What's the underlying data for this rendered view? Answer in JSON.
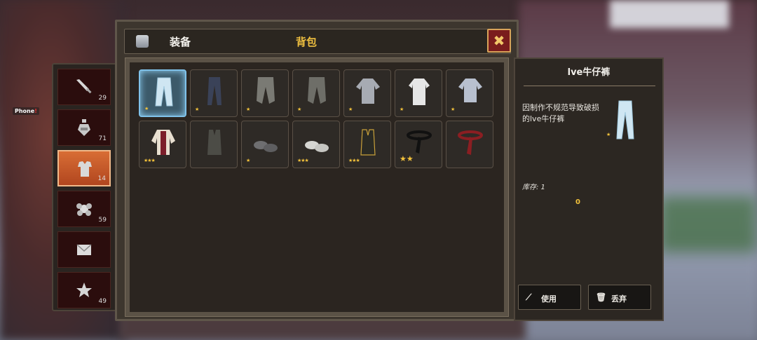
{
  "hud": {
    "phone_label": "Phone",
    "phone_alert": "!"
  },
  "sidebar": {
    "tabs": [
      {
        "icon": "sword-icon",
        "count": "29",
        "active": false
      },
      {
        "icon": "potion-icon",
        "count": "71",
        "active": false
      },
      {
        "icon": "armor-icon",
        "count": "14",
        "active": true
      },
      {
        "icon": "ore-icon",
        "count": "59",
        "active": false
      },
      {
        "icon": "mail-icon",
        "count": "",
        "active": false
      },
      {
        "icon": "star-icon",
        "count": "49",
        "active": false
      }
    ]
  },
  "panel": {
    "tab_equipment": "装备",
    "tab_bag": "背包",
    "close_label": "✖",
    "items": [
      {
        "name": "lve牛仔裤",
        "stars": "★",
        "selected": true
      },
      {
        "name": "dark-jeans",
        "stars": "★"
      },
      {
        "name": "gray-pants",
        "stars": "★"
      },
      {
        "name": "gray-pants-2",
        "stars": "★"
      },
      {
        "name": "gray-shirt",
        "stars": "★"
      },
      {
        "name": "white-shirt",
        "stars": "★"
      },
      {
        "name": "blue-shirt",
        "stars": "★"
      },
      {
        "name": "striped-jacket",
        "stars": "★★★"
      },
      {
        "name": "dark-vest",
        "stars": ""
      },
      {
        "name": "gray-shoes",
        "stars": "★"
      },
      {
        "name": "white-shoes",
        "stars": "★★★"
      },
      {
        "name": "black-gold-vest",
        "stars": "★★★"
      },
      {
        "name": "black-belt",
        "stars": "★★"
      },
      {
        "name": "red-belt",
        "stars": ""
      }
    ]
  },
  "detail": {
    "title": "lve牛仔裤",
    "description": "因制作不规范导致破损的lve牛仔裤",
    "preview_stars": "★",
    "stock_label": "库存: 1",
    "quantity": "0",
    "use_label": "使用",
    "discard_label": "丢弃"
  },
  "colors": {
    "accent_gold": "#f0c040",
    "active_tab": "#d86d35",
    "selected_slot": "#7fc2ea"
  }
}
